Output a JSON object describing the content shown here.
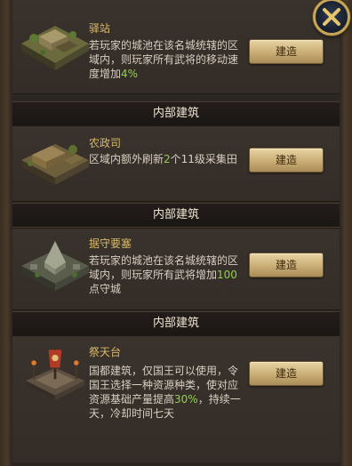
{
  "cards": [
    {
      "title": "驿站",
      "desc_parts": [
        "若玩家的城池在该名城统辖的区域内，则玩家所有武将的移动速度增加",
        "4%",
        ""
      ],
      "button": "建造",
      "icon": "relay-station-icon"
    },
    {
      "section": "内部建筑",
      "title": "农政司",
      "desc_parts": [
        "区域内额外刷新",
        "2",
        "个11级采集田"
      ],
      "button": "建造",
      "icon": "farm-office-icon"
    },
    {
      "section": "内部建筑",
      "title": "据守要塞",
      "desc_parts": [
        "若玩家的城池在该名城统辖的区域内，则玩家所有武将增加",
        "100",
        "点守城"
      ],
      "button": "建造",
      "icon": "fortress-icon"
    },
    {
      "section": "内部建筑",
      "title": "祭天台",
      "desc_parts": [
        "国都建筑，仅国王可以使用，令国王选择一种资源种类，使对应资源基础产量提高",
        "30%",
        "，持续一天，冷却时间七天"
      ],
      "button": "建造",
      "icon": "altar-icon"
    }
  ],
  "colors": {
    "accent_gold": "#d9b968",
    "highlight_green": "#8fd34a",
    "button": "#c9ad74"
  }
}
